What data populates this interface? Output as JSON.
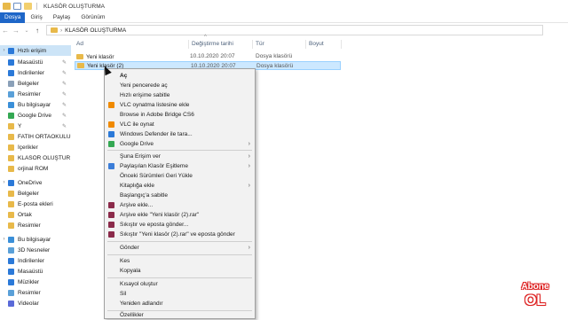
{
  "window": {
    "title": "KLASÖR OLUŞTURMA"
  },
  "ribbon": {
    "tabs": [
      "Dosya",
      "Giriş",
      "Paylaş",
      "Görünüm"
    ]
  },
  "address": {
    "path": "KLASÖR OLUŞTURMA"
  },
  "sidebar": {
    "items": [
      {
        "label": "Hızlı erişim",
        "icon": "star-icon",
        "color": "#2b79d8"
      },
      {
        "label": "Masaüstü",
        "icon": "desktop-icon",
        "color": "#2b79d8"
      },
      {
        "label": "İndirilenler",
        "icon": "download-icon",
        "color": "#2b79d8"
      },
      {
        "label": "Belgeler",
        "icon": "documents-icon",
        "color": "#8aa0b8"
      },
      {
        "label": "Resimler",
        "icon": "pictures-icon",
        "color": "#5aa0d8"
      },
      {
        "label": "Bu bilgisayar",
        "icon": "computer-icon",
        "color": "#3a8fd8"
      },
      {
        "label": "Google Drive",
        "icon": "google-drive-icon",
        "color": "#34a853"
      },
      {
        "label": "Y",
        "icon": "folder-icon",
        "color": "#e8b94a"
      },
      {
        "label": "FATİH ORTAOKULU",
        "icon": "folder-icon",
        "color": "#e8b94a"
      },
      {
        "label": "İçerikler",
        "icon": "folder-icon",
        "color": "#e8b94a"
      },
      {
        "label": "KLASÖR OLUŞTUR",
        "icon": "folder-icon",
        "color": "#e8b94a"
      },
      {
        "label": "orjinal ROM",
        "icon": "folder-icon",
        "color": "#e8b94a"
      },
      {
        "label": "OneDrive",
        "icon": "cloud-icon",
        "color": "#2b79d8"
      },
      {
        "label": "Belgeler",
        "icon": "folder-icon",
        "color": "#e8b94a"
      },
      {
        "label": "E-posta ekleri",
        "icon": "folder-icon",
        "color": "#e8b94a"
      },
      {
        "label": "Ortak",
        "icon": "folder-icon",
        "color": "#e8b94a"
      },
      {
        "label": "Resimler",
        "icon": "folder-icon",
        "color": "#e8b94a"
      },
      {
        "label": "Bu bilgisayar",
        "icon": "computer-icon",
        "color": "#3a8fd8"
      },
      {
        "label": "3D Nesneler",
        "icon": "3d-objects-icon",
        "color": "#5aa0d8"
      },
      {
        "label": "İndirilenler",
        "icon": "download-icon",
        "color": "#2b79d8"
      },
      {
        "label": "Masaüstü",
        "icon": "desktop-icon",
        "color": "#2b79d8"
      },
      {
        "label": "Müzikler",
        "icon": "music-icon",
        "color": "#2b79d8"
      },
      {
        "label": "Resimler",
        "icon": "pictures-icon",
        "color": "#5aa0d8"
      },
      {
        "label": "Videolar",
        "icon": "video-icon",
        "color": "#5a6ad8"
      }
    ]
  },
  "columns": [
    "Ad",
    "Değiştirme tarihi",
    "Tür",
    "Boyut"
  ],
  "files": [
    {
      "name": "Yeni klasör",
      "date": "10.10.2020 20:07",
      "type": "Dosya klasörü"
    },
    {
      "name": "Yeni klasör (2)",
      "date": "10.10.2020 20:07",
      "type": "Dosya klasörü"
    }
  ],
  "context_menu": {
    "items": [
      {
        "label": "Aç"
      },
      {
        "label": "Yeni pencerede aç"
      },
      {
        "label": "Hızlı erişime sabitle"
      },
      {
        "label": "VLC oynatma listesine ekle"
      },
      {
        "label": "Browse in Adobe Bridge CS6"
      },
      {
        "label": "VLC ile oynat"
      },
      {
        "label": "Windows Defender ile tara..."
      },
      {
        "label": "Google Drive"
      },
      {
        "label": "Şuna Erişim ver"
      },
      {
        "label": "Paylaşılan Klasör Eşitleme"
      },
      {
        "label": "Önceki Sürümleri Geri Yükle"
      },
      {
        "label": "Kitaplığa ekle"
      },
      {
        "label": "Başlangıç'a sabitle"
      },
      {
        "label": "Arşive ekle..."
      },
      {
        "label": "Arşive ekle \"Yeni klasör (2).rar\""
      },
      {
        "label": "Sıkıştır ve eposta gönder..."
      },
      {
        "label": "Sıkıştır \"Yeni klasör (2).rar\" ve eposta gönder"
      },
      {
        "label": "Gönder"
      },
      {
        "label": "Kes"
      },
      {
        "label": "Kopyala"
      },
      {
        "label": "Kısayol oluştur"
      },
      {
        "label": "Sil"
      },
      {
        "label": "Yeniden adlandır"
      },
      {
        "label": "Özellikler"
      }
    ]
  },
  "watermark": {
    "line1": "Abone",
    "line2": "OL"
  }
}
